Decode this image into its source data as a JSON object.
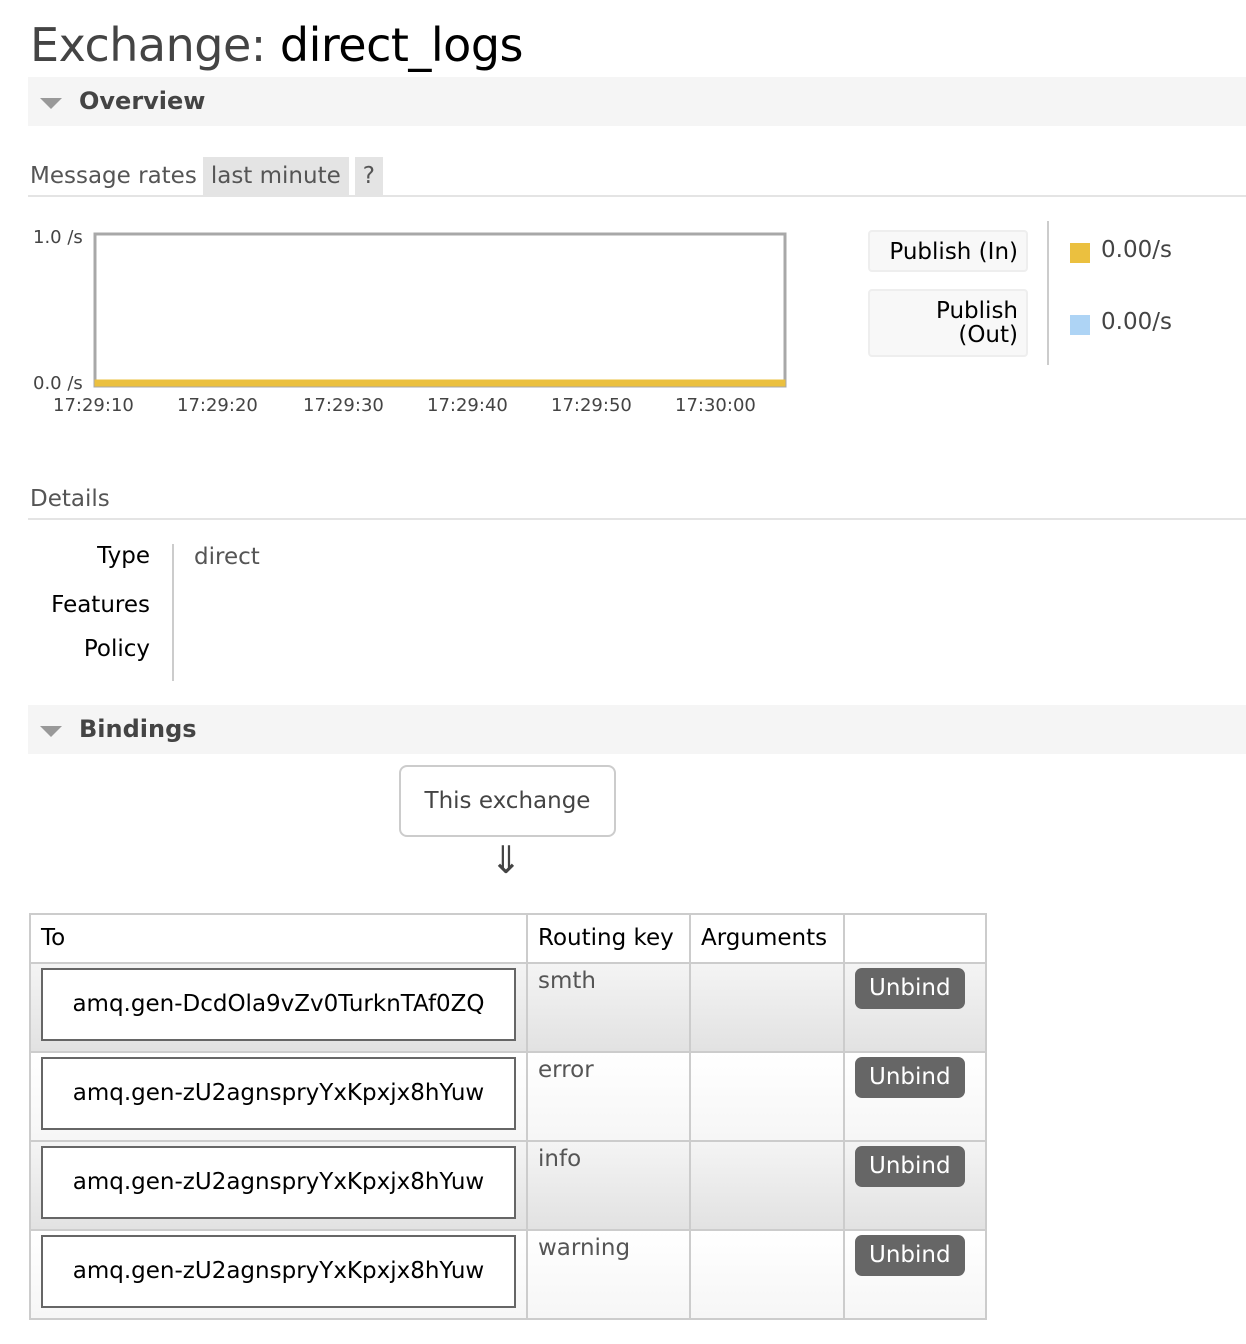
{
  "title": {
    "prefix": "Exchange:",
    "name": "direct_logs"
  },
  "overview": {
    "heading": "Overview",
    "rates_label": "Message rates",
    "range": "last minute",
    "help": "?",
    "legend": [
      {
        "label": "Publish (In)",
        "value": "0.00/s",
        "color": "#ebc03f"
      },
      {
        "label": "Publish (Out)",
        "value": "0.00/s",
        "color": "#aed4f5"
      }
    ]
  },
  "chart_data": {
    "type": "line",
    "x": [
      "17:29:10",
      "17:29:20",
      "17:29:30",
      "17:29:40",
      "17:29:50",
      "17:30:00"
    ],
    "yticks": [
      "1.0 /s",
      "0.0 /s"
    ],
    "ylim": [
      0,
      1
    ],
    "series": [
      {
        "name": "Publish (In)",
        "values": [
          0,
          0,
          0,
          0,
          0,
          0
        ],
        "color": "#ebc03f"
      },
      {
        "name": "Publish (Out)",
        "values": [
          0,
          0,
          0,
          0,
          0,
          0
        ],
        "color": "#aed4f5"
      }
    ]
  },
  "details": {
    "heading": "Details",
    "rows": [
      {
        "label": "Type",
        "value": "direct"
      },
      {
        "label": "Features",
        "value": ""
      },
      {
        "label": "Policy",
        "value": ""
      }
    ]
  },
  "bindings": {
    "heading": "Bindings",
    "source": "This exchange",
    "arrow": "⇓",
    "columns": [
      "To",
      "Routing key",
      "Arguments",
      ""
    ],
    "rows": [
      {
        "to": "amq.gen-DcdOla9vZv0TurknTAf0ZQ",
        "key": "smth",
        "args": "",
        "action": "Unbind"
      },
      {
        "to": "amq.gen-zU2agnspryYxKpxjx8hYuw",
        "key": "error",
        "args": "",
        "action": "Unbind"
      },
      {
        "to": "amq.gen-zU2agnspryYxKpxjx8hYuw",
        "key": "info",
        "args": "",
        "action": "Unbind"
      },
      {
        "to": "amq.gen-zU2agnspryYxKpxjx8hYuw",
        "key": "warning",
        "args": "",
        "action": "Unbind"
      }
    ]
  }
}
